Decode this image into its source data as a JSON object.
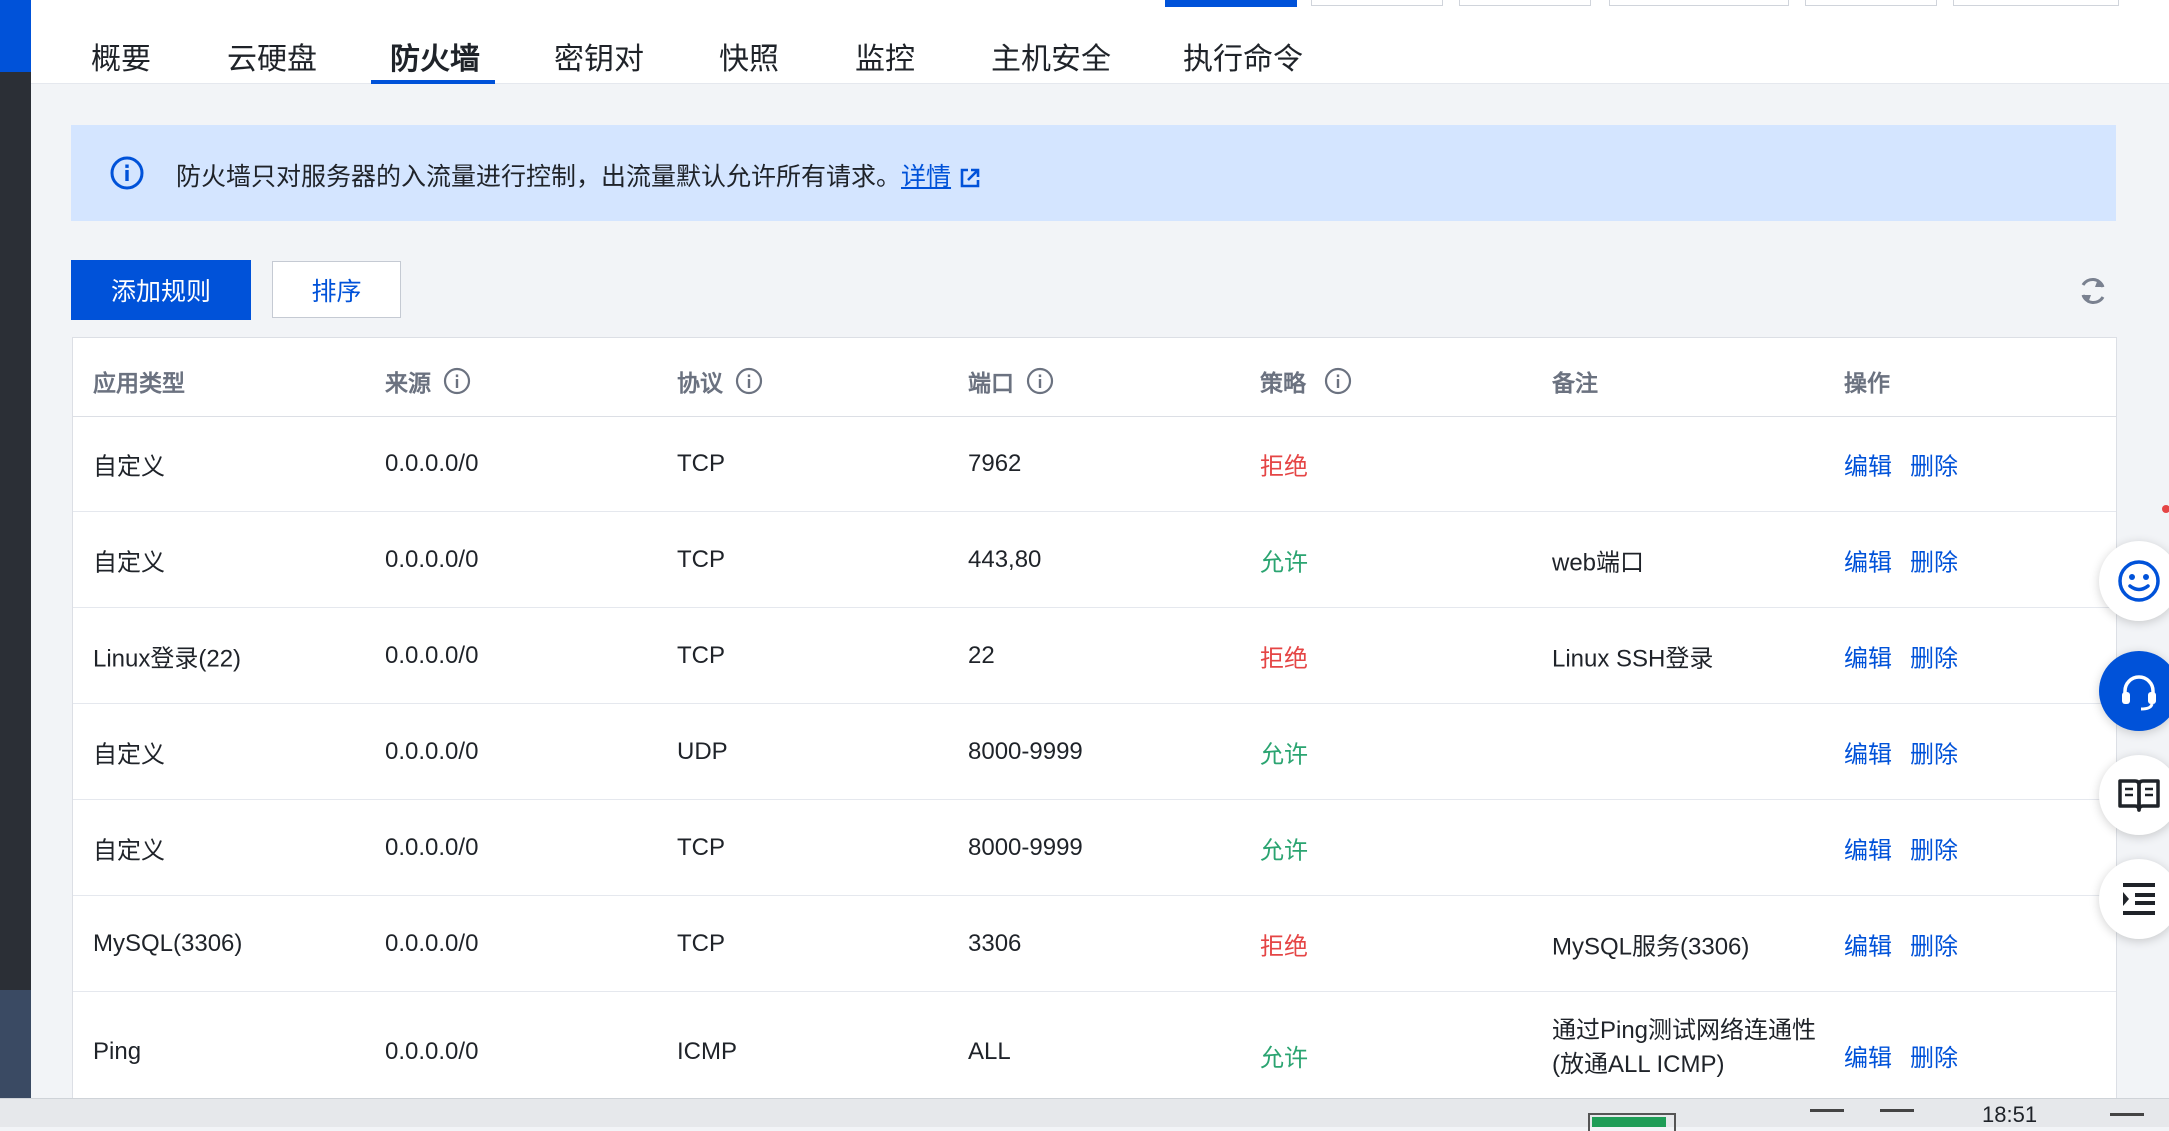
{
  "tabs": [
    {
      "label": "概要"
    },
    {
      "label": "云硬盘"
    },
    {
      "label": "防火墙"
    },
    {
      "label": "密钥对"
    },
    {
      "label": "快照"
    },
    {
      "label": "监控"
    },
    {
      "label": "主机安全"
    },
    {
      "label": "执行命令"
    }
  ],
  "active_tab": "防火墙",
  "notice": {
    "text": "防火墙只对服务器的入流量进行控制，出流量默认允许所有请求。",
    "link_label": "详情"
  },
  "toolbar": {
    "add_rule_label": "添加规则",
    "sort_label": "排序"
  },
  "table": {
    "columns": [
      "应用类型",
      "来源",
      "协议",
      "端口",
      "策略",
      "备注",
      "操作"
    ],
    "rows": [
      {
        "app_type": "自定义",
        "source": "0.0.0.0/0",
        "protocol": "TCP",
        "port": "7962",
        "policy": "拒绝",
        "policy_kind": "deny",
        "note": "",
        "edit": "编辑",
        "delete": "删除"
      },
      {
        "app_type": "自定义",
        "source": "0.0.0.0/0",
        "protocol": "TCP",
        "port": "443,80",
        "policy": "允许",
        "policy_kind": "allow",
        "note": "web端口",
        "edit": "编辑",
        "delete": "删除"
      },
      {
        "app_type": "Linux登录(22)",
        "source": "0.0.0.0/0",
        "protocol": "TCP",
        "port": "22",
        "policy": "拒绝",
        "policy_kind": "deny",
        "note": "Linux SSH登录",
        "edit": "编辑",
        "delete": "删除"
      },
      {
        "app_type": "自定义",
        "source": "0.0.0.0/0",
        "protocol": "UDP",
        "port": "8000-9999",
        "policy": "允许",
        "policy_kind": "allow",
        "note": "",
        "edit": "编辑",
        "delete": "删除"
      },
      {
        "app_type": "自定义",
        "source": "0.0.0.0/0",
        "protocol": "TCP",
        "port": "8000-9999",
        "policy": "允许",
        "policy_kind": "allow",
        "note": "",
        "edit": "编辑",
        "delete": "删除"
      },
      {
        "app_type": "MySQL(3306)",
        "source": "0.0.0.0/0",
        "protocol": "TCP",
        "port": "3306",
        "policy": "拒绝",
        "policy_kind": "deny",
        "note": "MySQL服务(3306)",
        "edit": "编辑",
        "delete": "删除"
      },
      {
        "app_type": "Ping",
        "source": "0.0.0.0/0",
        "protocol": "ICMP",
        "port": "ALL",
        "policy": "允许",
        "policy_kind": "allow",
        "note": "通过Ping测试网络连通性(放通ALL ICMP)",
        "edit": "编辑",
        "delete": "删除"
      }
    ]
  },
  "float_buttons": [
    {
      "icon": "smile-icon"
    },
    {
      "icon": "headset-icon"
    },
    {
      "icon": "book-icon"
    },
    {
      "icon": "list-indent-icon"
    }
  ],
  "taskbar": {
    "clock": "18:51"
  },
  "colors": {
    "primary": "#0052d9",
    "deny": "#e54545",
    "allow": "#2ba471",
    "notice_bg": "#d4e5ff"
  }
}
